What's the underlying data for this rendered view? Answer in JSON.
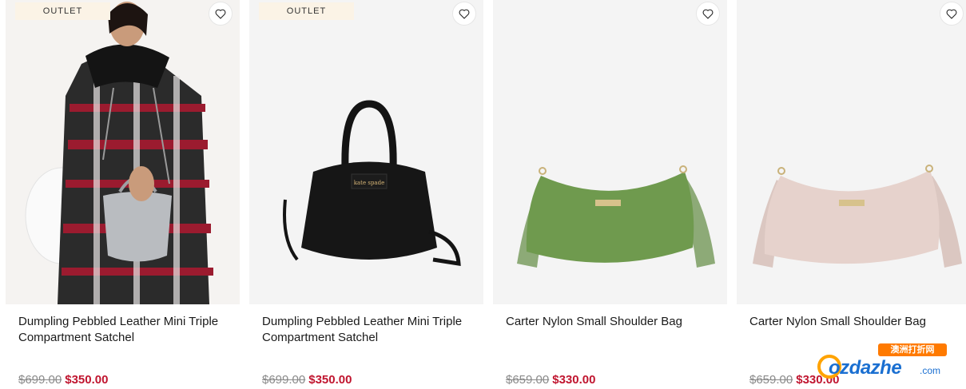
{
  "products": [
    {
      "badge": "OUTLET",
      "name": "Dumpling Pebbled Leather Mini Triple Compartment Satchel",
      "was_price": "$699.00",
      "sale_price": "$350.00",
      "image": "model-with-grey-satchel"
    },
    {
      "badge": "OUTLET",
      "name": "Dumpling Pebbled Leather Mini Triple Compartment Satchel",
      "was_price": "$699.00",
      "sale_price": "$350.00",
      "image": "black-satchel",
      "logo_text": "kate spade"
    },
    {
      "badge": "",
      "name": "Carter Nylon Small Shoulder Bag",
      "was_price": "$659.00",
      "sale_price": "$330.00",
      "image": "green-shoulder-bag",
      "bag_color": "#6f9a4e"
    },
    {
      "badge": "",
      "name": "Carter Nylon Small Shoulder Bag",
      "was_price": "$659.00",
      "sale_price": "$330.00",
      "image": "pink-shoulder-bag",
      "bag_color": "#e6d2cc"
    }
  ],
  "icons": {
    "favorite": "heart-outline-icon"
  },
  "watermark": {
    "cn_text": "澳洲打折网",
    "logo": "ozdazhe",
    "suffix": ".com"
  },
  "colors": {
    "sale": "#c0152f",
    "was": "#8a8a8a",
    "badge_bg": "#fbf3e6"
  }
}
